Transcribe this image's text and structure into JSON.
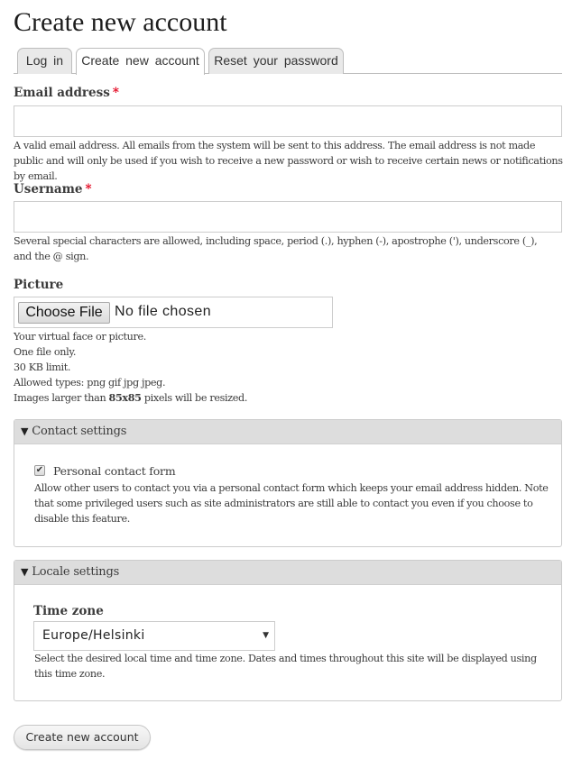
{
  "page": {
    "title": "Create new account"
  },
  "tabs": [
    {
      "label": "Log in",
      "active": false
    },
    {
      "label": "Create new account",
      "active": true
    },
    {
      "label": "Reset your password",
      "active": false
    }
  ],
  "email": {
    "label": "Email address",
    "required_marker": "*",
    "value": "",
    "description": "A valid email address. All emails from the system will be sent to this address. The email address is not made public and will only be used if you wish to receive a new password or wish to receive certain news or notifications by email."
  },
  "username": {
    "label": "Username",
    "required_marker": "*",
    "value": "",
    "description": "Several special characters are allowed, including space, period (.), hyphen (-), apostrophe ('), underscore (_), and the @ sign."
  },
  "picture": {
    "label": "Picture",
    "button_label": "Choose File",
    "status": "No file chosen",
    "description_lines": [
      "Your virtual face or picture.",
      "One file only.",
      "30 KB limit.",
      "Allowed types: png gif jpg jpeg."
    ],
    "resize_prefix": "Images larger than ",
    "resize_dimensions": "85x85",
    "resize_suffix": " pixels will be resized."
  },
  "contact_settings": {
    "legend": "Contact settings",
    "expanded_icon": "▼",
    "checkbox_label": "Personal contact form",
    "checkbox_checked": true,
    "description": "Allow other users to contact you via a personal contact form which keeps your email address hidden. Note that some privileged users such as site administrators are still able to contact you even if you choose to disable this feature."
  },
  "locale_settings": {
    "legend": "Locale settings",
    "expanded_icon": "▼",
    "timezone_label": "Time zone",
    "timezone_value": "Europe/Helsinki",
    "dropdown_icon": "▼",
    "description": "Select the desired local time and time zone. Dates and times throughout this site will be displayed using this time zone."
  },
  "submit": {
    "label": "Create new account"
  },
  "colors": {
    "required": "#e3001b",
    "legend_bg": "#dddddd",
    "tab_inactive_bg": "#e9e9e9"
  }
}
